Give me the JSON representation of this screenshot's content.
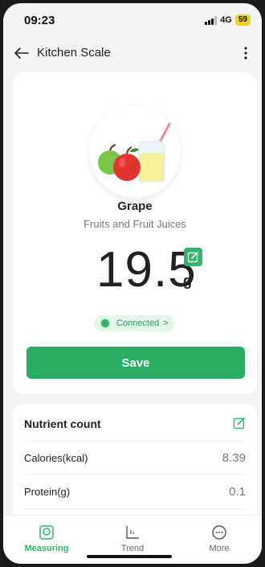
{
  "status_bar": {
    "time": "09:23",
    "network": "4G",
    "battery": "59"
  },
  "header": {
    "title": "Kitchen Scale"
  },
  "food": {
    "name": "Grape",
    "category": "Fruits and Fruit Juices",
    "weight": "19.5",
    "unit": "g",
    "image_icon": "apples-and-juice-icon"
  },
  "connection": {
    "status": "Connected",
    "chevron": ">"
  },
  "save_label": "Save",
  "nutrients": {
    "title": "Nutrient count",
    "rows": [
      {
        "label": "Calories(kcal)",
        "value": "8.39"
      },
      {
        "label": "Protein(g)",
        "value": "0.1"
      }
    ]
  },
  "nav": {
    "items": [
      {
        "label": "Measuring",
        "icon": "scale-icon",
        "active": true
      },
      {
        "label": "Trend",
        "icon": "trend-chart-icon",
        "active": false
      },
      {
        "label": "More",
        "icon": "more-icon",
        "active": false
      }
    ]
  },
  "colors": {
    "accent": "#2fb46a",
    "button": "#29ae66",
    "battery": "#f2d21b"
  }
}
